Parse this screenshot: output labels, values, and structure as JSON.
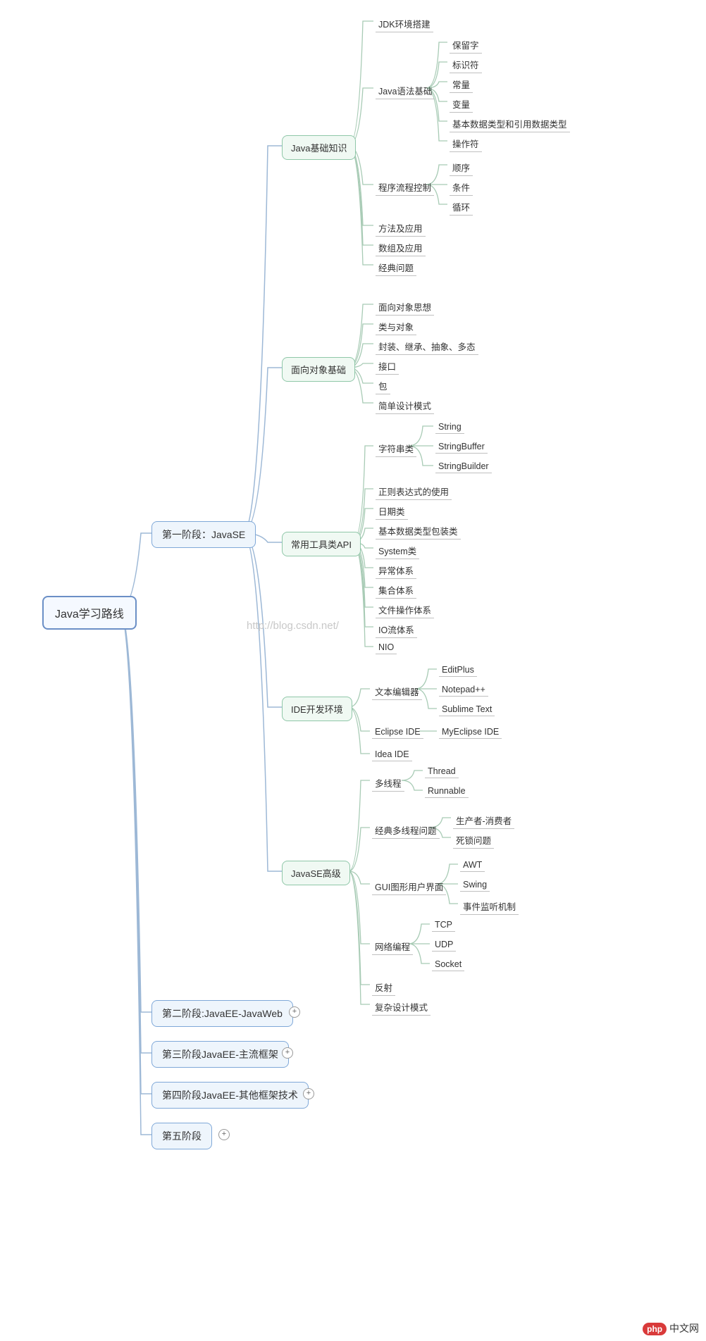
{
  "chart_data": {
    "type": "mindmap",
    "root": "Java学习路线",
    "children": [
      {
        "label": "第一阶段：JavaSE",
        "children": [
          {
            "label": "Java基础知识",
            "children": [
              {
                "label": "JDK环境搭建"
              },
              {
                "label": "Java语法基础",
                "children": [
                  {
                    "label": "保留字"
                  },
                  {
                    "label": "标识符"
                  },
                  {
                    "label": "常量"
                  },
                  {
                    "label": "变量"
                  },
                  {
                    "label": "基本数据类型和引用数据类型"
                  },
                  {
                    "label": "操作符"
                  }
                ]
              },
              {
                "label": "程序流程控制",
                "children": [
                  {
                    "label": "顺序"
                  },
                  {
                    "label": "条件"
                  },
                  {
                    "label": "循环"
                  }
                ]
              },
              {
                "label": "方法及应用"
              },
              {
                "label": "数组及应用"
              },
              {
                "label": "经典问题"
              }
            ]
          },
          {
            "label": "面向对象基础",
            "children": [
              {
                "label": "面向对象思想"
              },
              {
                "label": "类与对象"
              },
              {
                "label": "封装、继承、抽象、多态"
              },
              {
                "label": "接口"
              },
              {
                "label": "包"
              },
              {
                "label": "简单设计模式"
              }
            ]
          },
          {
            "label": "常用工具类API",
            "children": [
              {
                "label": "字符串类",
                "children": [
                  {
                    "label": "String"
                  },
                  {
                    "label": "StringBuffer"
                  },
                  {
                    "label": "StringBuilder"
                  }
                ]
              },
              {
                "label": "正则表达式的使用"
              },
              {
                "label": "日期类"
              },
              {
                "label": "基本数据类型包装类"
              },
              {
                "label": "System类"
              },
              {
                "label": "异常体系"
              },
              {
                "label": "集合体系"
              },
              {
                "label": "文件操作体系"
              },
              {
                "label": "IO流体系"
              },
              {
                "label": "NIO"
              }
            ]
          },
          {
            "label": "IDE开发环境",
            "children": [
              {
                "label": "文本编辑器",
                "children": [
                  {
                    "label": "EditPlus"
                  },
                  {
                    "label": "Notepad++"
                  },
                  {
                    "label": "Sublime Text"
                  }
                ]
              },
              {
                "label": "Eclipse IDE",
                "children": [
                  {
                    "label": "MyEclipse IDE"
                  }
                ]
              },
              {
                "label": "Idea IDE"
              }
            ]
          },
          {
            "label": "JavaSE高级",
            "children": [
              {
                "label": "多线程",
                "children": [
                  {
                    "label": "Thread"
                  },
                  {
                    "label": "Runnable"
                  }
                ]
              },
              {
                "label": "经典多线程问题",
                "children": [
                  {
                    "label": "生产者-消费者"
                  },
                  {
                    "label": "死锁问题"
                  }
                ]
              },
              {
                "label": "GUI图形用户界面",
                "children": [
                  {
                    "label": "AWT"
                  },
                  {
                    "label": "Swing"
                  },
                  {
                    "label": "事件监听机制"
                  }
                ]
              },
              {
                "label": "网络编程",
                "children": [
                  {
                    "label": "TCP"
                  },
                  {
                    "label": "UDP"
                  },
                  {
                    "label": "Socket"
                  }
                ]
              },
              {
                "label": "反射"
              },
              {
                "label": "复杂设计模式"
              }
            ]
          }
        ]
      },
      {
        "label": "第二阶段:JavaEE-JavaWeb",
        "collapsed": true
      },
      {
        "label": "第三阶段JavaEE-主流框架",
        "collapsed": true
      },
      {
        "label": "第四阶段JavaEE-其他框架技术",
        "collapsed": true
      },
      {
        "label": "第五阶段",
        "collapsed": true
      }
    ]
  },
  "watermark": "http://blog.csdn.net/",
  "logo_text": "中文网",
  "logo_php": "php"
}
